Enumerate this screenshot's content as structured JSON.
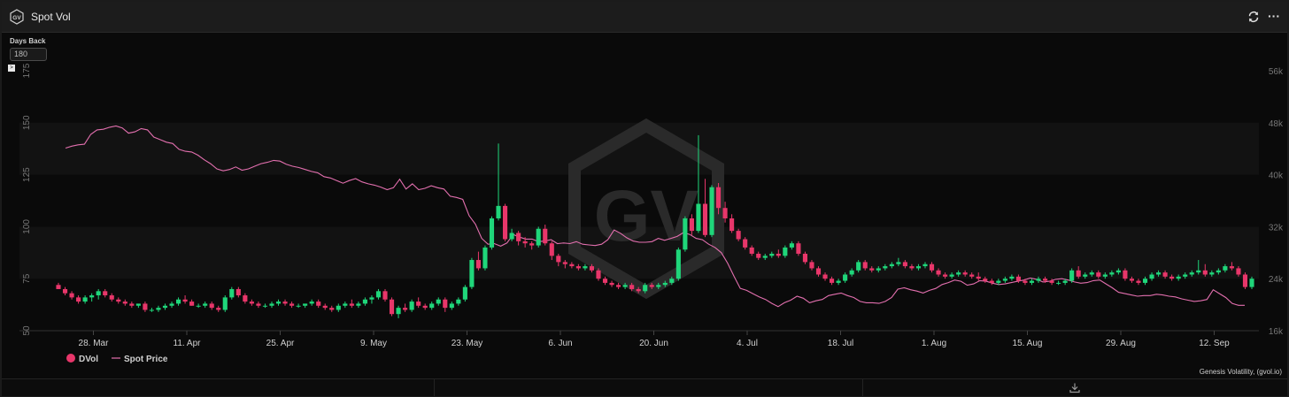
{
  "header": {
    "title": "Spot Vol",
    "logo_text": "GV",
    "refresh_icon": "refresh-icon",
    "menu_icon": "more-horizontal-icon",
    "menu_glyph": "···"
  },
  "controls": {
    "days_back_label": "Days Back",
    "days_back_value": "180",
    "collapse_glyph": ">"
  },
  "footer": {
    "attribution": "Genesis Volatility, (gvol.io)",
    "download_icon": "download-icon"
  },
  "colors": {
    "up": "#1fd67a",
    "down": "#e8366a",
    "spot_line": "#e26fae",
    "band": "#121212",
    "axis_text": "#777777"
  },
  "chart_data": {
    "type": "candlestick+line",
    "watermark": "GV",
    "x_tick_labels": [
      "28. Mar",
      "11. Apr",
      "25. Apr",
      "9. May",
      "23. May",
      "6. Jun",
      "20. Jun",
      "4. Jul",
      "18. Jul",
      "1. Aug",
      "15. Aug",
      "29. Aug",
      "12. Sep"
    ],
    "y_left": {
      "min": 50,
      "max": 175,
      "ticks": [
        50,
        75,
        100,
        125,
        150,
        175
      ]
    },
    "y_right": {
      "min": 16000,
      "max": 56000,
      "ticks": [
        16000,
        24000,
        32000,
        40000,
        48000,
        56000
      ],
      "tick_labels": [
        "16k",
        "24k",
        "32k",
        "40k",
        "48k",
        "56k"
      ]
    },
    "legend": [
      {
        "name": "DVol",
        "marker": "circle"
      },
      {
        "name": "Spot Price",
        "marker": "line"
      }
    ],
    "dvol_candles_ohlc": [
      [
        72,
        73,
        70,
        70
      ],
      [
        70,
        71,
        67,
        68
      ],
      [
        68,
        69,
        65,
        66
      ],
      [
        66,
        67,
        63,
        64
      ],
      [
        64,
        67,
        63,
        66
      ],
      [
        66,
        68,
        64,
        67
      ],
      [
        67,
        70,
        65,
        69
      ],
      [
        69,
        70,
        66,
        67
      ],
      [
        67,
        68,
        64,
        65
      ],
      [
        65,
        66,
        63,
        64
      ],
      [
        64,
        65,
        62,
        63
      ],
      [
        63,
        64,
        61,
        62
      ],
      [
        62,
        63,
        61,
        63
      ],
      [
        63,
        64,
        59,
        60
      ],
      [
        60,
        61,
        59,
        60
      ],
      [
        60,
        62,
        59,
        61
      ],
      [
        61,
        63,
        60,
        62
      ],
      [
        62,
        64,
        61,
        63
      ],
      [
        63,
        66,
        62,
        65
      ],
      [
        65,
        67,
        63,
        64
      ],
      [
        64,
        65,
        62,
        62
      ],
      [
        62,
        63,
        61,
        62
      ],
      [
        62,
        64,
        61,
        63
      ],
      [
        63,
        64,
        60,
        61
      ],
      [
        61,
        62,
        59,
        60
      ],
      [
        60,
        67,
        59,
        66
      ],
      [
        66,
        71,
        65,
        70
      ],
      [
        70,
        71,
        66,
        67
      ],
      [
        67,
        68,
        63,
        64
      ],
      [
        64,
        65,
        62,
        63
      ],
      [
        63,
        64,
        61,
        62
      ],
      [
        62,
        63,
        61,
        62
      ],
      [
        62,
        64,
        61,
        63
      ],
      [
        63,
        65,
        62,
        64
      ],
      [
        64,
        65,
        62,
        63
      ],
      [
        63,
        64,
        61,
        62
      ],
      [
        62,
        63,
        61,
        62
      ],
      [
        62,
        63,
        61,
        63
      ],
      [
        63,
        65,
        62,
        64
      ],
      [
        64,
        65,
        61,
        62
      ],
      [
        62,
        63,
        60,
        61
      ],
      [
        61,
        62,
        59,
        60
      ],
      [
        60,
        63,
        59,
        62
      ],
      [
        62,
        64,
        61,
        63
      ],
      [
        63,
        65,
        61,
        62
      ],
      [
        62,
        64,
        61,
        63
      ],
      [
        63,
        66,
        62,
        65
      ],
      [
        65,
        67,
        63,
        66
      ],
      [
        66,
        70,
        65,
        69
      ],
      [
        69,
        70,
        64,
        65
      ],
      [
        65,
        66,
        57,
        58
      ],
      [
        58,
        62,
        56,
        61
      ],
      [
        61,
        63,
        59,
        60
      ],
      [
        60,
        65,
        59,
        64
      ],
      [
        64,
        66,
        61,
        62
      ],
      [
        62,
        63,
        60,
        61
      ],
      [
        61,
        64,
        60,
        63
      ],
      [
        63,
        66,
        62,
        65
      ],
      [
        65,
        66,
        59,
        61
      ],
      [
        61,
        64,
        60,
        63
      ],
      [
        63,
        66,
        62,
        65
      ],
      [
        65,
        72,
        64,
        71
      ],
      [
        71,
        85,
        70,
        84
      ],
      [
        84,
        88,
        79,
        80
      ],
      [
        80,
        91,
        79,
        90
      ],
      [
        90,
        105,
        89,
        104
      ],
      [
        104,
        140,
        103,
        110
      ],
      [
        110,
        111,
        93,
        94
      ],
      [
        94,
        99,
        93,
        97
      ],
      [
        97,
        98,
        91,
        93
      ],
      [
        93,
        95,
        90,
        92
      ],
      [
        92,
        93,
        89,
        91
      ],
      [
        91,
        100,
        90,
        99
      ],
      [
        99,
        101,
        91,
        92
      ],
      [
        92,
        93,
        84,
        86
      ],
      [
        86,
        87,
        81,
        83
      ],
      [
        83,
        84,
        80,
        82
      ],
      [
        82,
        83,
        80,
        81
      ],
      [
        81,
        82,
        79,
        80
      ],
      [
        80,
        82,
        79,
        81
      ],
      [
        81,
        82,
        78,
        79
      ],
      [
        79,
        80,
        74,
        75
      ],
      [
        75,
        76,
        72,
        73
      ],
      [
        73,
        74,
        71,
        72
      ],
      [
        72,
        73,
        70,
        71
      ],
      [
        71,
        73,
        70,
        72
      ],
      [
        72,
        73,
        69,
        70
      ],
      [
        70,
        71,
        68,
        69
      ],
      [
        69,
        73,
        68,
        72
      ],
      [
        72,
        73,
        70,
        71
      ],
      [
        71,
        73,
        70,
        72
      ],
      [
        72,
        74,
        71,
        73
      ],
      [
        73,
        76,
        72,
        75
      ],
      [
        75,
        90,
        74,
        89
      ],
      [
        89,
        105,
        88,
        104
      ],
      [
        104,
        106,
        96,
        98
      ],
      [
        98,
        144,
        97,
        111
      ],
      [
        111,
        123,
        95,
        96
      ],
      [
        96,
        120,
        95,
        119
      ],
      [
        119,
        121,
        106,
        109
      ],
      [
        109,
        112,
        102,
        104
      ],
      [
        104,
        106,
        97,
        98
      ],
      [
        98,
        99,
        93,
        94
      ],
      [
        94,
        95,
        89,
        90
      ],
      [
        90,
        91,
        86,
        87
      ],
      [
        87,
        88,
        84,
        85
      ],
      [
        85,
        87,
        84,
        86
      ],
      [
        86,
        88,
        85,
        87
      ],
      [
        87,
        89,
        85,
        86
      ],
      [
        86,
        91,
        85,
        90
      ],
      [
        90,
        93,
        89,
        92
      ],
      [
        92,
        93,
        86,
        87
      ],
      [
        87,
        88,
        82,
        83
      ],
      [
        83,
        84,
        79,
        80
      ],
      [
        80,
        81,
        76,
        77
      ],
      [
        77,
        78,
        74,
        75
      ],
      [
        75,
        76,
        72,
        73
      ],
      [
        73,
        75,
        72,
        74
      ],
      [
        74,
        78,
        73,
        77
      ],
      [
        77,
        80,
        76,
        79
      ],
      [
        79,
        84,
        78,
        83
      ],
      [
        83,
        84,
        79,
        80
      ],
      [
        80,
        81,
        78,
        79
      ],
      [
        79,
        81,
        78,
        80
      ],
      [
        80,
        82,
        79,
        81
      ],
      [
        81,
        83,
        80,
        82
      ],
      [
        82,
        85,
        81,
        83
      ],
      [
        83,
        84,
        80,
        81
      ],
      [
        81,
        82,
        79,
        80
      ],
      [
        80,
        82,
        79,
        81
      ],
      [
        81,
        83,
        80,
        82
      ],
      [
        82,
        83,
        78,
        79
      ],
      [
        79,
        80,
        76,
        77
      ],
      [
        77,
        78,
        75,
        76
      ],
      [
        76,
        78,
        75,
        77
      ],
      [
        77,
        79,
        76,
        78
      ],
      [
        78,
        79,
        76,
        77
      ],
      [
        77,
        78,
        75,
        76
      ],
      [
        76,
        78,
        74,
        75
      ],
      [
        75,
        76,
        73,
        74
      ],
      [
        74,
        75,
        72,
        73
      ],
      [
        73,
        75,
        72,
        74
      ],
      [
        74,
        76,
        73,
        75
      ],
      [
        75,
        77,
        74,
        76
      ],
      [
        76,
        77,
        73,
        74
      ],
      [
        74,
        75,
        72,
        73
      ],
      [
        73,
        75,
        72,
        74
      ],
      [
        74,
        76,
        73,
        75
      ],
      [
        75,
        76,
        73,
        74
      ],
      [
        74,
        75,
        72,
        73
      ],
      [
        73,
        74,
        72,
        73
      ],
      [
        73,
        75,
        72,
        74
      ],
      [
        74,
        80,
        73,
        79
      ],
      [
        79,
        81,
        75,
        76
      ],
      [
        76,
        78,
        75,
        77
      ],
      [
        77,
        79,
        76,
        78
      ],
      [
        78,
        79,
        75,
        76
      ],
      [
        76,
        78,
        75,
        77
      ],
      [
        77,
        79,
        76,
        78
      ],
      [
        78,
        80,
        77,
        79
      ],
      [
        79,
        80,
        74,
        75
      ],
      [
        75,
        76,
        73,
        74
      ],
      [
        74,
        75,
        72,
        73
      ],
      [
        73,
        76,
        72,
        75
      ],
      [
        75,
        78,
        74,
        77
      ],
      [
        77,
        79,
        76,
        78
      ],
      [
        78,
        79,
        75,
        76
      ],
      [
        76,
        77,
        74,
        75
      ],
      [
        75,
        77,
        74,
        76
      ],
      [
        76,
        78,
        75,
        77
      ],
      [
        77,
        79,
        76,
        78
      ],
      [
        78,
        84,
        77,
        79
      ],
      [
        79,
        82,
        76,
        77
      ],
      [
        77,
        79,
        76,
        78
      ],
      [
        78,
        80,
        77,
        79
      ],
      [
        79,
        82,
        78,
        81
      ],
      [
        81,
        83,
        79,
        80
      ],
      [
        80,
        81,
        76,
        77
      ],
      [
        77,
        78,
        70,
        71
      ],
      [
        71,
        76,
        70,
        75
      ]
    ],
    "spot_price": [
      44100,
      44400,
      44600,
      44700,
      46200,
      46900,
      47000,
      47300,
      47500,
      47200,
      46400,
      46600,
      47100,
      46900,
      45800,
      45400,
      45000,
      44800,
      43900,
      43600,
      43500,
      43000,
      42300,
      41700,
      40900,
      40600,
      40800,
      41200,
      40700,
      40900,
      41300,
      41700,
      41900,
      42200,
      42100,
      41600,
      41300,
      41100,
      40800,
      40500,
      40300,
      39700,
      39500,
      39100,
      38700,
      39100,
      39400,
      38900,
      38600,
      38400,
      38100,
      37700,
      38000,
      39300,
      37800,
      38600,
      37700,
      37900,
      38300,
      38000,
      37800,
      36700,
      36500,
      36200,
      33700,
      32400,
      30200,
      29300,
      29400,
      29000,
      29500,
      30800,
      30400,
      30100,
      30100,
      29700,
      29800,
      30000,
      29400,
      29500,
      29400,
      29700,
      29300,
      29200,
      29100,
      29300,
      30000,
      31500,
      31000,
      30300,
      29800,
      29600,
      29600,
      29700,
      30200,
      29900,
      30200,
      30500,
      31100,
      30800,
      30200,
      30000,
      29300,
      28800,
      28000,
      26400,
      24400,
      22500,
      22200,
      21700,
      21200,
      20800,
      20200,
      19700,
      20300,
      20700,
      21300,
      21000,
      20300,
      20600,
      20800,
      21400,
      21600,
      21800,
      21400,
      21100,
      20500,
      20300,
      20300,
      20200,
      20500,
      21100,
      22400,
      22600,
      22300,
      22100,
      21800,
      22200,
      22500,
      23100,
      23400,
      23800,
      23600,
      23000,
      23200,
      23700,
      23600,
      23300,
      23100,
      23200,
      23400,
      23600,
      23800,
      24100,
      23900,
      23500,
      23600,
      23900,
      24000,
      23800,
      23500,
      23300,
      23400,
      23700,
      23800,
      23200,
      22600,
      21900,
      21700,
      21500,
      21300,
      21400,
      21400,
      21600,
      21500,
      21300,
      21200,
      20900,
      20700,
      20500,
      20600,
      20800,
      22300,
      21700,
      21100,
      20200,
      19900,
      19900
    ]
  }
}
